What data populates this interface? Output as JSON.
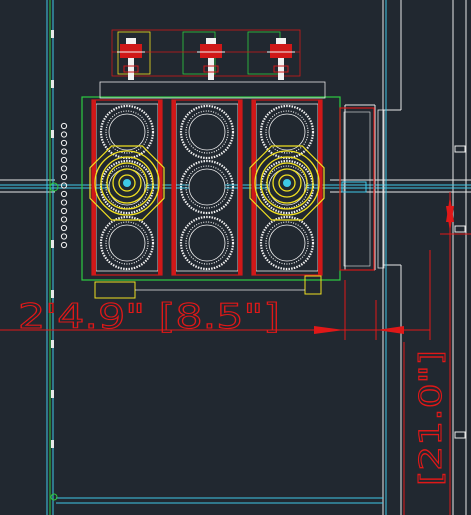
{
  "canvas": {
    "background": "#212830",
    "layer_colors": {
      "dimension": "#e01818",
      "equipment": "#f2f2f2",
      "frame_red": "#d01818",
      "frame_green": "#2ecc40",
      "fan_yellow": "#f0e020",
      "pipe_cyan": "#3ec8e8",
      "wall_white": "#e8e8e8"
    }
  },
  "dimensions": {
    "horizontal_label": "2'4.9\" [8.5\"]",
    "vertical_label": "[21.0\"]"
  },
  "equipment": {
    "coil_count": 9,
    "coil_columns": 3,
    "coil_rows": 3,
    "valve_assemblies": 3,
    "fan_rings": 2
  },
  "icons": [
    "arrow-right-icon",
    "arrow-up-icon",
    "arrow-down-icon",
    "arrow-left-icon"
  ]
}
